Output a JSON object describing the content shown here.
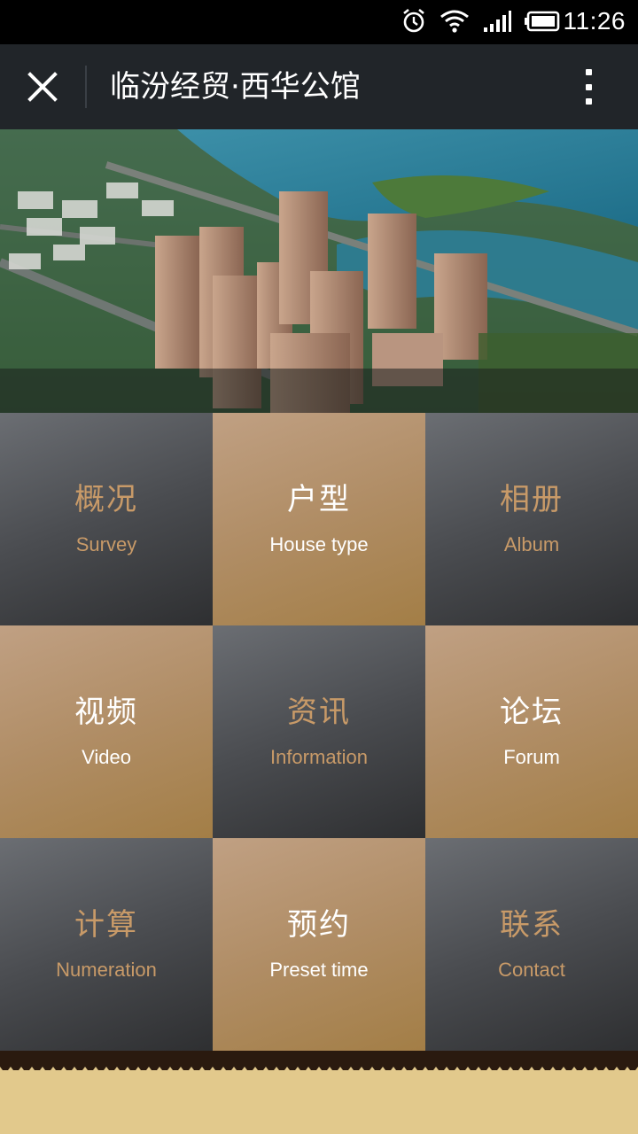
{
  "status_bar": {
    "time": "11:26",
    "icons": [
      "alarm-icon",
      "wifi-icon",
      "signal-icon",
      "battery-icon"
    ]
  },
  "nav": {
    "title": "临汾经贸·西华公馆",
    "close_icon": "close-icon",
    "menu_icon": "more-vert-icon"
  },
  "banner": {
    "image": "aerial-city-rendering"
  },
  "menu": [
    {
      "zh": "概况",
      "en": "Survey",
      "style": "dark"
    },
    {
      "zh": "户型",
      "en": "House type",
      "style": "gold"
    },
    {
      "zh": "相册",
      "en": "Album",
      "style": "dark"
    },
    {
      "zh": "视频",
      "en": "Video",
      "style": "gold"
    },
    {
      "zh": "资讯",
      "en": "Information",
      "style": "dark"
    },
    {
      "zh": "论坛",
      "en": "Forum",
      "style": "gold"
    },
    {
      "zh": "计算",
      "en": "Numeration",
      "style": "dark"
    },
    {
      "zh": "预约",
      "en": "Preset time",
      "style": "gold"
    },
    {
      "zh": "联系",
      "en": "Contact",
      "style": "dark"
    }
  ],
  "colors": {
    "nav_bg": "#212529",
    "tile_dark_text": "#c89a68",
    "tile_gold_text": "#ffffff",
    "footer_bg": "#e2c98c"
  }
}
